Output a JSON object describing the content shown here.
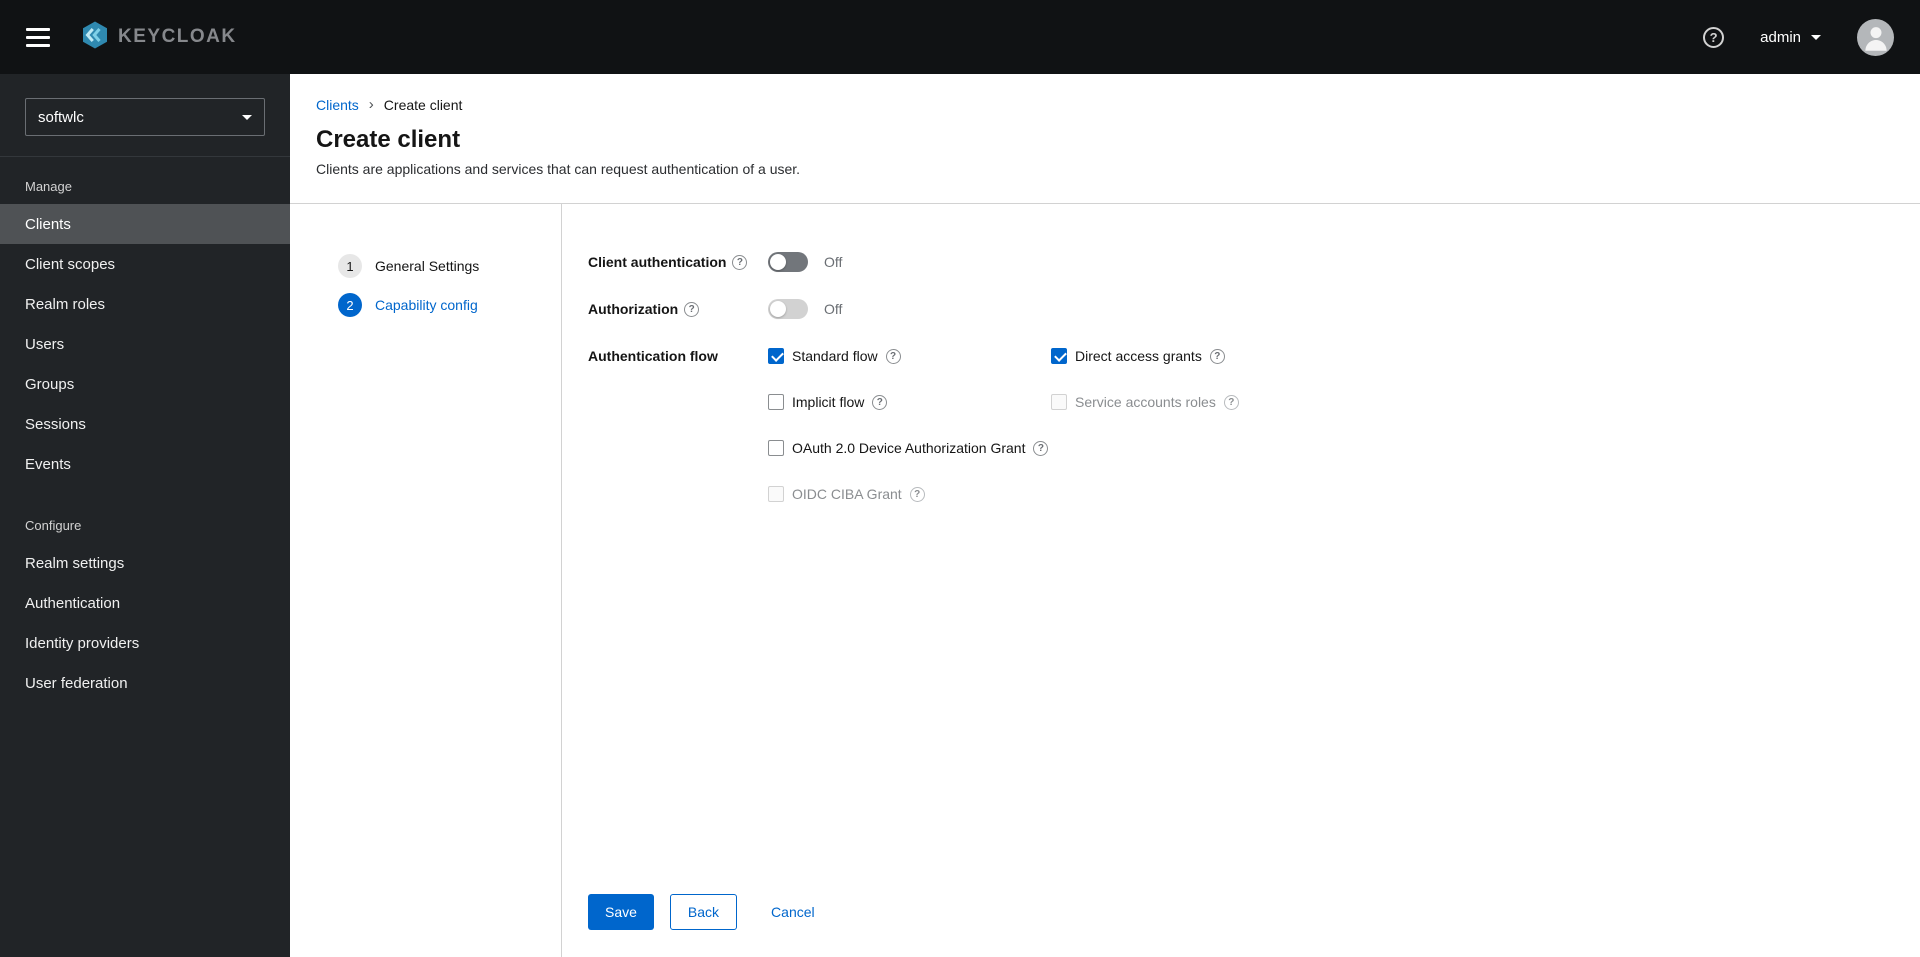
{
  "header": {
    "brand": "KEYCLOAK",
    "username": "admin"
  },
  "sidebar": {
    "realm_selector": {
      "value": "softwlc"
    },
    "sections": [
      {
        "label": "Manage",
        "items": [
          {
            "label": "Clients",
            "selected": true
          },
          {
            "label": "Client scopes",
            "selected": false
          },
          {
            "label": "Realm roles",
            "selected": false
          },
          {
            "label": "Users",
            "selected": false
          },
          {
            "label": "Groups",
            "selected": false
          },
          {
            "label": "Sessions",
            "selected": false
          },
          {
            "label": "Events",
            "selected": false
          }
        ]
      },
      {
        "label": "Configure",
        "items": [
          {
            "label": "Realm settings",
            "selected": false
          },
          {
            "label": "Authentication",
            "selected": false
          },
          {
            "label": "Identity providers",
            "selected": false
          },
          {
            "label": "User federation",
            "selected": false
          }
        ]
      }
    ]
  },
  "breadcrumb": {
    "items": [
      {
        "label": "Clients",
        "link": true
      },
      {
        "label": "Create client",
        "link": false
      }
    ]
  },
  "page": {
    "title": "Create client",
    "subtitle": "Clients are applications and services that can request authentication of a user."
  },
  "wizard": {
    "steps": [
      {
        "number": "1",
        "label": "General Settings",
        "current": false
      },
      {
        "number": "2",
        "label": "Capability config",
        "current": true
      }
    ]
  },
  "form": {
    "client_authentication": {
      "label": "Client authentication",
      "value": "Off",
      "enabled": true
    },
    "authorization": {
      "label": "Authorization",
      "value": "Off",
      "enabled": false
    },
    "authentication_flow": {
      "label": "Authentication flow",
      "options": [
        {
          "label": "Standard flow",
          "checked": true,
          "disabled": false
        },
        {
          "label": "Direct access grants",
          "checked": true,
          "disabled": false
        },
        {
          "label": "Implicit flow",
          "checked": false,
          "disabled": false
        },
        {
          "label": "Service accounts roles",
          "checked": false,
          "disabled": true
        },
        {
          "label": "OAuth 2.0 Device Authorization Grant",
          "checked": false,
          "disabled": false
        },
        {
          "label": "OIDC CIBA Grant",
          "checked": false,
          "disabled": true
        }
      ]
    },
    "actions": {
      "save": "Save",
      "back": "Back",
      "cancel": "Cancel"
    }
  },
  "colors": {
    "accent": "#0066cc",
    "header_bg": "#101214",
    "sidebar_bg": "#212427",
    "sidebar_selected_bg": "#4f5255"
  }
}
